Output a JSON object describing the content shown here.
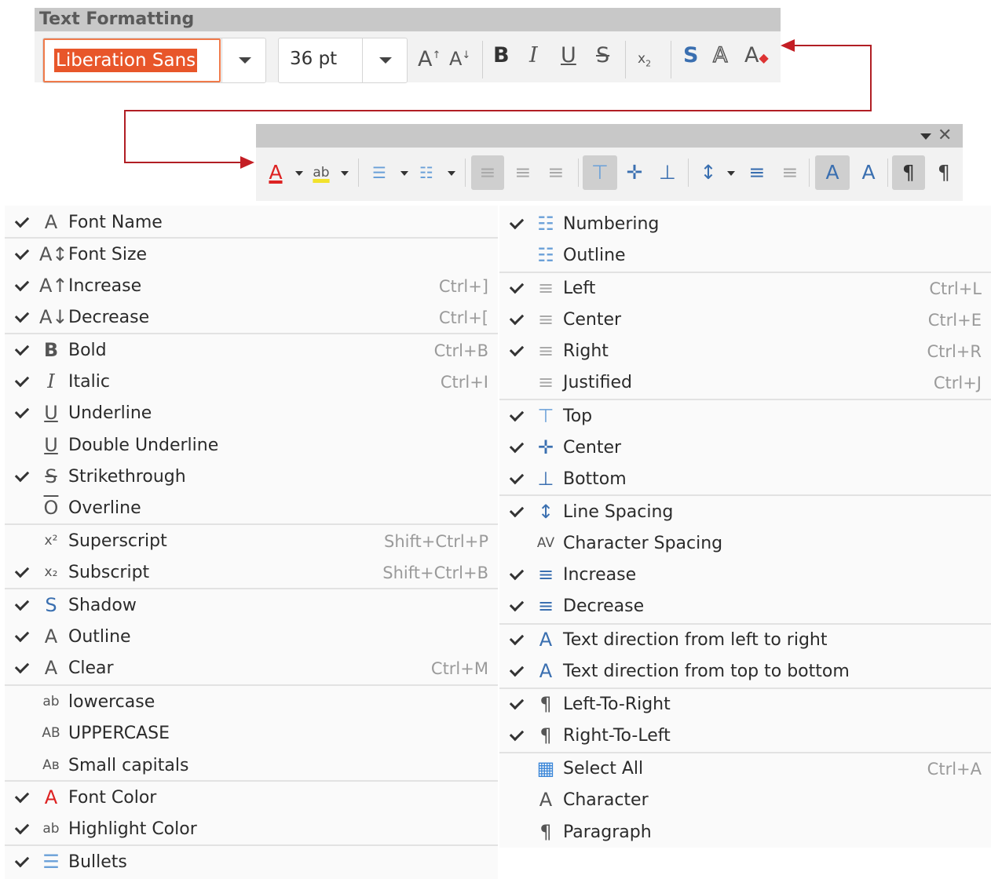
{
  "toolbar": {
    "title": "Text Formatting",
    "font_name": "Liberation Sans",
    "font_size": "36 pt"
  },
  "left_menu": [
    {
      "id": "font-name",
      "label": "Font Name",
      "checked": true,
      "shortcut": "",
      "icon": "A"
    },
    {
      "id": "font-size",
      "label": "Font Size",
      "checked": true,
      "shortcut": "",
      "icon": "A↕"
    },
    {
      "id": "increase",
      "label": "Increase",
      "checked": true,
      "shortcut": "Ctrl+]",
      "icon": "A↑"
    },
    {
      "id": "decrease",
      "label": "Decrease",
      "checked": true,
      "shortcut": "Ctrl+[",
      "icon": "A↓"
    },
    {
      "id": "bold",
      "label": "Bold",
      "checked": true,
      "shortcut": "Ctrl+B",
      "icon": "B"
    },
    {
      "id": "italic",
      "label": "Italic",
      "checked": true,
      "shortcut": "Ctrl+I",
      "icon": "I"
    },
    {
      "id": "underline",
      "label": "Underline",
      "checked": true,
      "shortcut": "",
      "icon": "U"
    },
    {
      "id": "double-underline",
      "label": "Double Underline",
      "checked": false,
      "shortcut": "",
      "icon": "U"
    },
    {
      "id": "strikethrough",
      "label": "Strikethrough",
      "checked": true,
      "shortcut": "",
      "icon": "S"
    },
    {
      "id": "overline",
      "label": "Overline",
      "checked": false,
      "shortcut": "",
      "icon": "O"
    },
    {
      "id": "superscript",
      "label": "Superscript",
      "checked": false,
      "shortcut": "Shift+Ctrl+P",
      "icon": "x²"
    },
    {
      "id": "subscript",
      "label": "Subscript",
      "checked": true,
      "shortcut": "Shift+Ctrl+B",
      "icon": "x₂"
    },
    {
      "id": "shadow",
      "label": "Shadow",
      "checked": true,
      "shortcut": "",
      "icon": "S"
    },
    {
      "id": "outline",
      "label": "Outline",
      "checked": true,
      "shortcut": "",
      "icon": "A"
    },
    {
      "id": "clear",
      "label": "Clear",
      "checked": true,
      "shortcut": "Ctrl+M",
      "icon": "A"
    },
    {
      "id": "lowercase",
      "label": "lowercase",
      "checked": false,
      "shortcut": "",
      "icon": "ab"
    },
    {
      "id": "uppercase",
      "label": "UPPERCASE",
      "checked": false,
      "shortcut": "",
      "icon": "AB"
    },
    {
      "id": "small-capitals",
      "label": "Small capitals",
      "checked": false,
      "shortcut": "",
      "icon": "Aв"
    },
    {
      "id": "font-color",
      "label": "Font Color",
      "checked": true,
      "shortcut": "",
      "icon": "A"
    },
    {
      "id": "highlight-color",
      "label": "Highlight Color",
      "checked": true,
      "shortcut": "",
      "icon": "ab"
    },
    {
      "id": "bullets",
      "label": "Bullets",
      "checked": true,
      "shortcut": "",
      "icon": "☰"
    }
  ],
  "right_menu": [
    {
      "id": "numbering",
      "label": "Numbering",
      "checked": true,
      "shortcut": "",
      "icon": "☷"
    },
    {
      "id": "outline-list",
      "label": "Outline",
      "checked": false,
      "shortcut": "",
      "icon": "☷"
    },
    {
      "id": "left",
      "label": "Left",
      "checked": true,
      "shortcut": "Ctrl+L",
      "icon": "≡"
    },
    {
      "id": "center",
      "label": "Center",
      "checked": true,
      "shortcut": "Ctrl+E",
      "icon": "≡"
    },
    {
      "id": "right",
      "label": "Right",
      "checked": true,
      "shortcut": "Ctrl+R",
      "icon": "≡"
    },
    {
      "id": "justified",
      "label": "Justified",
      "checked": false,
      "shortcut": "Ctrl+J",
      "icon": "≡"
    },
    {
      "id": "top",
      "label": "Top",
      "checked": true,
      "shortcut": "",
      "icon": "⊤"
    },
    {
      "id": "v-center",
      "label": "Center",
      "checked": true,
      "shortcut": "",
      "icon": "✛"
    },
    {
      "id": "bottom",
      "label": "Bottom",
      "checked": true,
      "shortcut": "",
      "icon": "⊥"
    },
    {
      "id": "line-spacing",
      "label": "Line Spacing",
      "checked": true,
      "shortcut": "",
      "icon": "↕"
    },
    {
      "id": "character-spacing",
      "label": "Character Spacing",
      "checked": false,
      "shortcut": "",
      "icon": "AV"
    },
    {
      "id": "spacing-increase",
      "label": "Increase",
      "checked": true,
      "shortcut": "",
      "icon": "≡"
    },
    {
      "id": "spacing-decrease",
      "label": "Decrease",
      "checked": true,
      "shortcut": "",
      "icon": "≡"
    },
    {
      "id": "text-ltr",
      "label": "Text direction from left to right",
      "checked": true,
      "shortcut": "",
      "icon": "A"
    },
    {
      "id": "text-ttb",
      "label": "Text direction from top to bottom",
      "checked": true,
      "shortcut": "",
      "icon": "A"
    },
    {
      "id": "left-to-right",
      "label": "Left-To-Right",
      "checked": true,
      "shortcut": "",
      "icon": "¶"
    },
    {
      "id": "right-to-left",
      "label": "Right-To-Left",
      "checked": true,
      "shortcut": "",
      "icon": "¶"
    },
    {
      "id": "select-all",
      "label": "Select All",
      "checked": false,
      "shortcut": "Ctrl+A",
      "icon": "▦"
    },
    {
      "id": "character",
      "label": "Character",
      "checked": false,
      "shortcut": "",
      "icon": "A"
    },
    {
      "id": "paragraph",
      "label": "Paragraph",
      "checked": false,
      "shortcut": "",
      "icon": "¶"
    }
  ]
}
